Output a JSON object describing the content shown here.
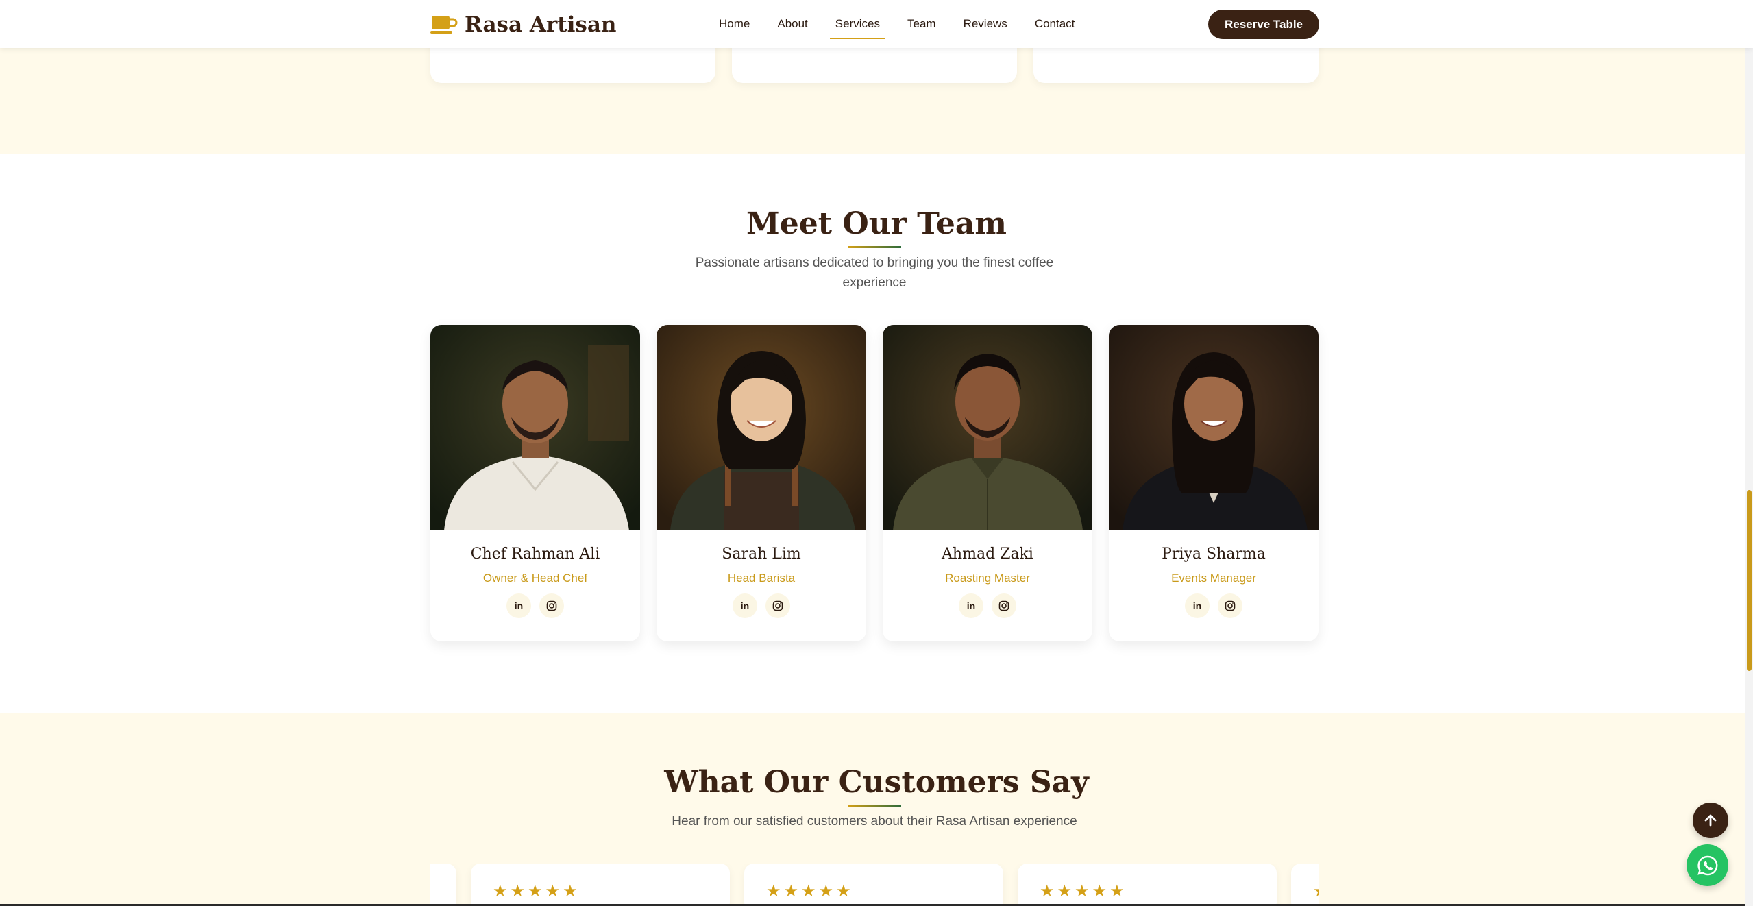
{
  "brand": {
    "name": "Rasa Artisan",
    "icon": "coffee-cup-icon"
  },
  "nav": {
    "links": [
      {
        "label": "Home"
      },
      {
        "label": "About"
      },
      {
        "label": "Services",
        "active": true
      },
      {
        "label": "Team"
      },
      {
        "label": "Reviews"
      },
      {
        "label": "Contact"
      }
    ],
    "reserve_label": "Reserve Table"
  },
  "team": {
    "title": "Meet Our Team",
    "subtitle": "Passionate artisans dedicated to bringing you the finest coffee experience",
    "members": [
      {
        "name": "Chef Rahman Ali",
        "role": "Owner & Head Chef",
        "linkedin": "in",
        "photo": "chef-portrait"
      },
      {
        "name": "Sarah Lim",
        "role": "Head Barista",
        "linkedin": "in",
        "photo": "barista-portrait"
      },
      {
        "name": "Ahmad Zaki",
        "role": "Roasting Master",
        "linkedin": "in",
        "photo": "roaster-portrait"
      },
      {
        "name": "Priya Sharma",
        "role": "Events Manager",
        "linkedin": "in",
        "photo": "manager-portrait"
      }
    ]
  },
  "testimonials": {
    "title": "What Our Customers Say",
    "subtitle": "Hear from our satisfied customers about their Rasa Artisan experience",
    "rating_stars": 5
  },
  "colors": {
    "accent": "#d4a017",
    "brand_dark": "#3a2214",
    "cream": "#fffaea",
    "whatsapp": "#25c363"
  }
}
